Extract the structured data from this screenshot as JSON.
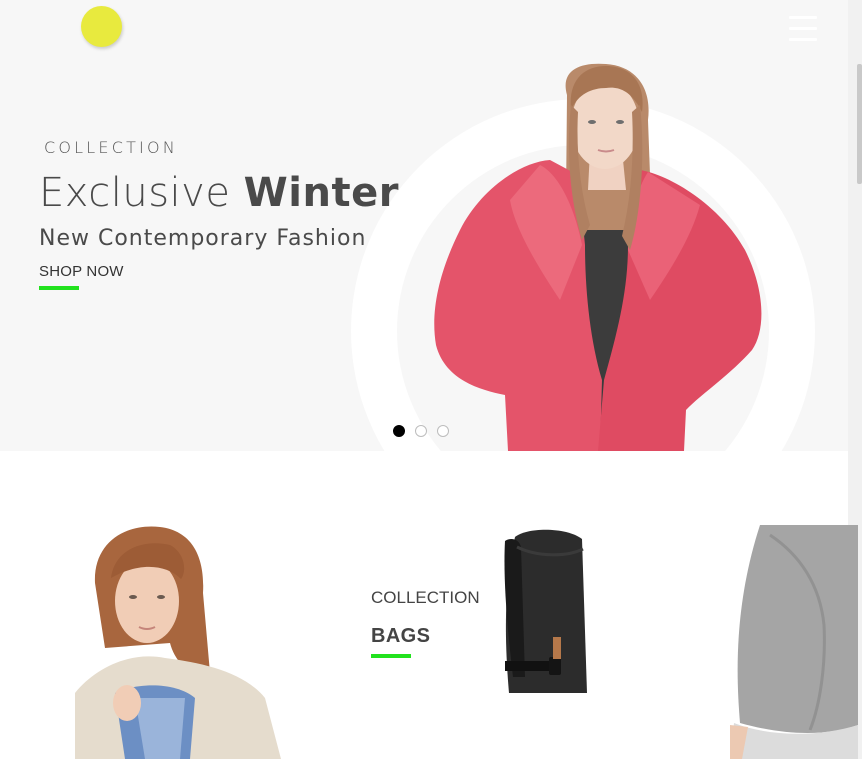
{
  "header": {
    "logo_icon": "circle-logo",
    "menu_icon": "hamburger-menu-icon"
  },
  "hero": {
    "kicker": "COLLECTION",
    "headline_light": "Exclusive ",
    "headline_bold": "Winter",
    "subline": "New Contemporary Fashion",
    "cta": "SHOP NOW",
    "slides": {
      "count": 3,
      "active": 1
    },
    "colors": {
      "accent": "#22e21e",
      "logo": "#e8ea3e",
      "coat": "#e4546a",
      "background": "#f7f7f7"
    }
  },
  "bags_card": {
    "kicker": "COLLECTION",
    "title": "BAGS"
  }
}
